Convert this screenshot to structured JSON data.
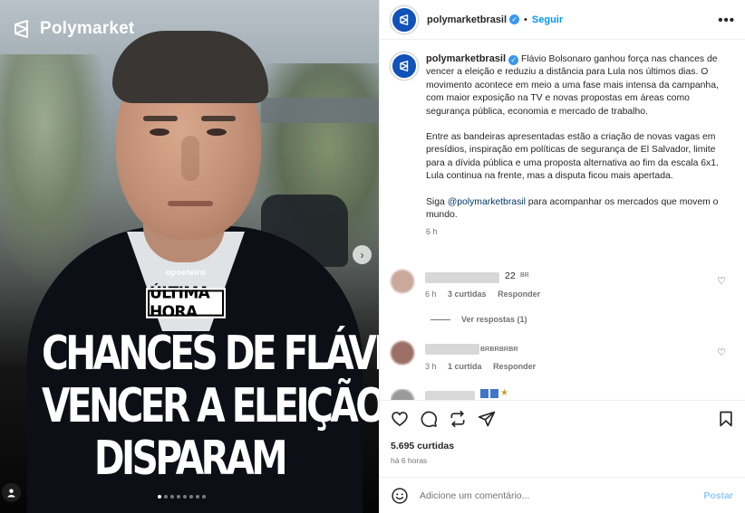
{
  "media": {
    "brand": "Polymarket",
    "credit": "opoeteiro",
    "badge": "ÚLTIMA HORA",
    "headline": [
      "CHANCES DE FLÁVIO",
      "VENCER A ELEIÇÃO",
      "DISPARAM"
    ],
    "carousel": {
      "count": 8,
      "active": 1
    }
  },
  "header": {
    "username": "polymarketbrasil",
    "dot": "•",
    "follow_label": "Seguir",
    "more_label": "•••"
  },
  "caption": {
    "username": "polymarketbrasil",
    "paragraph1": "Flávio Bolsonaro ganhou força nas chances de vencer a eleição e reduziu a distância para Lula nos últimos dias. O movimento acontece em meio a uma fase mais intensa da campanha, com maior exposição na TV e novas propostas em áreas como segurança pública, economia e mercado de trabalho.",
    "paragraph2": "Entre as bandeiras apresentadas estão a criação de novas vagas em presídios, inspiração em políticas de segurança de El Salvador, limite para a dívida pública e uma proposta alternativa ao fim da escala 6x1. Lula continua na frente, mas a disputa ficou mais apertada.",
    "p3_prefix": "Siga ",
    "mention": "@polymarketbrasil",
    "p3_suffix": " para acompanhar os mercados que movem o mundo.",
    "time": "6 h"
  },
  "comments": [
    {
      "text": "22",
      "flag": "BR",
      "time": "6 h",
      "likes": "3 curtidas",
      "reply": "Responder"
    },
    {
      "text": "BRBRBRBR",
      "time": "3 h",
      "likes": "1 curtida",
      "reply": "Responder"
    }
  ],
  "view_replies": "Ver respostas (1)",
  "likes": "5.695 curtidas",
  "posted_ago": "há 6 horas",
  "composer": {
    "placeholder": "Adicione um comentário...",
    "post_label": "Postar"
  }
}
